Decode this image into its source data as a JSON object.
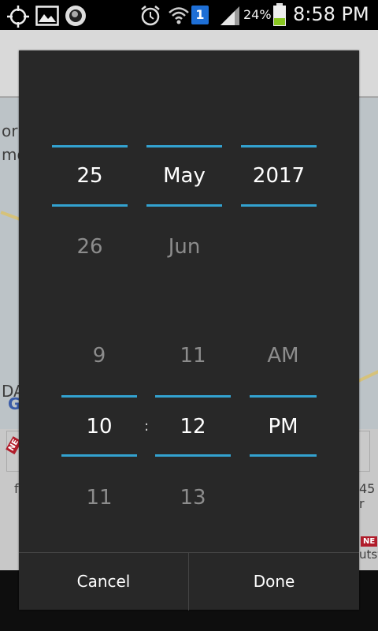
{
  "status_bar": {
    "battery_percent": "24%",
    "time": "8:58 PM",
    "notification_badge": "1",
    "icons": [
      "gps-icon",
      "gallery-icon",
      "circle-app-icon",
      "alarm-icon",
      "wifi-icon",
      "sim-badge-icon",
      "signal-icon",
      "battery-icon"
    ]
  },
  "background": {
    "text_1": "or",
    "text_2": "mo",
    "text_3": "DA",
    "text_4": "G",
    "text_5": "f",
    "text_6": "45 r",
    "text_7": "utst",
    "badge_1": "NE",
    "badge_2": "NE"
  },
  "picker": {
    "date": {
      "day": {
        "selected": "25",
        "next": "26"
      },
      "month": {
        "selected": "May",
        "next": "Jun"
      },
      "year": {
        "selected": "2017"
      }
    },
    "time": {
      "hour": {
        "prev": "9",
        "selected": "10",
        "next": "11"
      },
      "minute": {
        "prev": "11",
        "selected": "12",
        "next": "13"
      },
      "ampm": {
        "prev": "AM",
        "selected": "PM"
      },
      "separator": ":"
    },
    "accent_color": "#33a2d0"
  },
  "buttons": {
    "cancel": "Cancel",
    "done": "Done"
  }
}
